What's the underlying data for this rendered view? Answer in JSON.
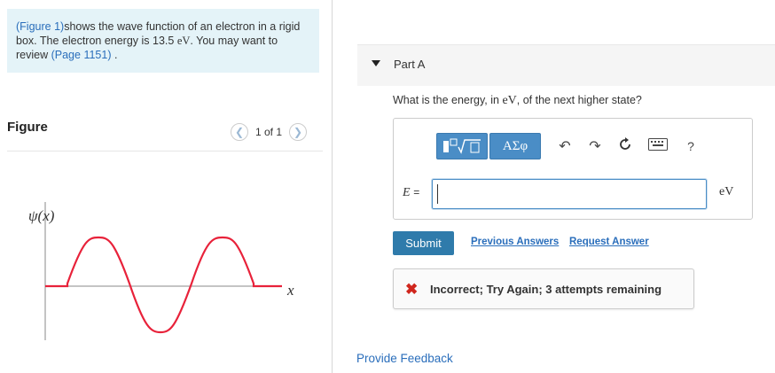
{
  "intro": {
    "figure_link": "(Figure 1)",
    "text_1": "shows the wave function of an electron in a rigid box. The electron energy is 13.5",
    "energy_unit": "eV",
    "text_2": ". You may want to review",
    "page_link": "(Page 1151)",
    "text_3": " ."
  },
  "figure": {
    "title": "Figure",
    "pager_count": "1 of 1",
    "prev_icon": "chevron-left-icon",
    "next_icon": "chevron-right-icon",
    "y_label": "ψ(x)",
    "x_label": "x"
  },
  "part": {
    "label": "Part A",
    "question_1": "What is the energy, in",
    "question_unit": "eV",
    "question_2": ", of the next higher state?"
  },
  "toolbar": {
    "templates_icon": "math-templates-icon",
    "symbols_label": "ΑΣφ",
    "undo_icon": "undo-icon",
    "redo_icon": "redo-icon",
    "reset_icon": "reset-icon",
    "keyboard_icon": "keyboard-icon",
    "help_label": "?"
  },
  "answer": {
    "variable_label": "E =",
    "value": "",
    "unit": "eV"
  },
  "actions": {
    "submit_label": "Submit",
    "previous_answers": "Previous Answers",
    "request_answer": "Request Answer"
  },
  "feedback": {
    "icon": "x-icon",
    "message": "Incorrect; Try Again; 3 attempts remaining"
  },
  "provide_feedback": "Provide Feedback",
  "colors": {
    "link": "#2a6ebb",
    "intro_bg": "#e4f3f8",
    "submit_bg": "#2f7bab",
    "error": "#d0261d",
    "wave": "#e8223a"
  }
}
